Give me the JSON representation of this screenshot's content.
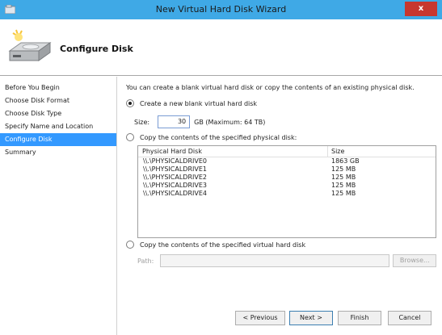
{
  "window": {
    "title": "New Virtual Hard Disk Wizard",
    "close_glyph": "x"
  },
  "header": {
    "title": "Configure Disk"
  },
  "sidebar": {
    "items": [
      {
        "label": "Before You Begin"
      },
      {
        "label": "Choose Disk Format"
      },
      {
        "label": "Choose Disk Type"
      },
      {
        "label": "Specify Name and Location"
      },
      {
        "label": "Configure Disk",
        "active": true
      },
      {
        "label": "Summary"
      }
    ]
  },
  "content": {
    "intro": "You can create a blank virtual hard disk or copy the contents of an existing physical disk.",
    "option_new": {
      "label": "Create a new blank virtual hard disk",
      "checked": true
    },
    "size": {
      "label": "Size:",
      "value": "30",
      "suffix": "GB (Maximum: 64 TB)"
    },
    "option_physical": {
      "label": "Copy the contents of the specified physical disk:",
      "checked": false
    },
    "table": {
      "columns": [
        "Physical Hard Disk",
        "Size"
      ],
      "rows": [
        {
          "name": "\\\\.\\PHYSICALDRIVE0",
          "size": "1863 GB"
        },
        {
          "name": "\\\\.\\PHYSICALDRIVE1",
          "size": "125 MB"
        },
        {
          "name": "\\\\.\\PHYSICALDRIVE2",
          "size": "125 MB"
        },
        {
          "name": "\\\\.\\PHYSICALDRIVE3",
          "size": "125 MB"
        },
        {
          "name": "\\\\.\\PHYSICALDRIVE4",
          "size": "125 MB"
        }
      ]
    },
    "option_virtual": {
      "label": "Copy the contents of the specified virtual hard disk",
      "checked": false
    },
    "path": {
      "label": "Path:",
      "value": "",
      "browse_label": "Browse..."
    }
  },
  "buttons": {
    "previous": "< Previous",
    "next": "Next >",
    "finish": "Finish",
    "cancel": "Cancel"
  },
  "colors": {
    "title_bar": "#3fa9e6",
    "close": "#c7372f",
    "selection": "#3399ff"
  }
}
